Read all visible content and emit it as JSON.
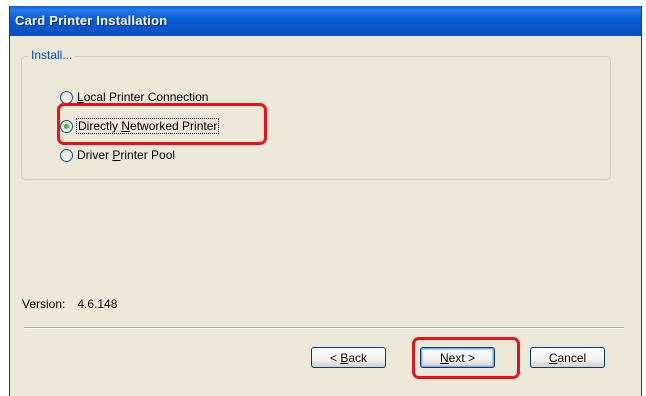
{
  "window": {
    "title": "Card Printer Installation"
  },
  "install_group": {
    "label": "Install...",
    "options": [
      {
        "label": "Local Printer Connection",
        "mnemonic": "L",
        "rest": "ocal Printer Connection",
        "checked": false
      },
      {
        "label_pre": "Directly ",
        "mnemonic": "N",
        "label_post": "etworked Printer",
        "checked": true
      },
      {
        "label_pre": "Driver ",
        "mnemonic": "P",
        "label_post": "rinter Pool",
        "checked": false
      }
    ]
  },
  "version": {
    "label": "Version:",
    "value": "4.6.148"
  },
  "buttons": {
    "back_prefix": "< ",
    "back_mnemonic": "B",
    "back_rest": "ack",
    "next_mnemonic": "N",
    "next_rest": "ext >",
    "cancel_mnemonic": "C",
    "cancel_rest": "ancel"
  },
  "colors": {
    "titlebar": "#0a5fd8",
    "dialog_bg": "#ece9d8",
    "highlight": "#e8121d",
    "group_label": "#0046d5"
  }
}
